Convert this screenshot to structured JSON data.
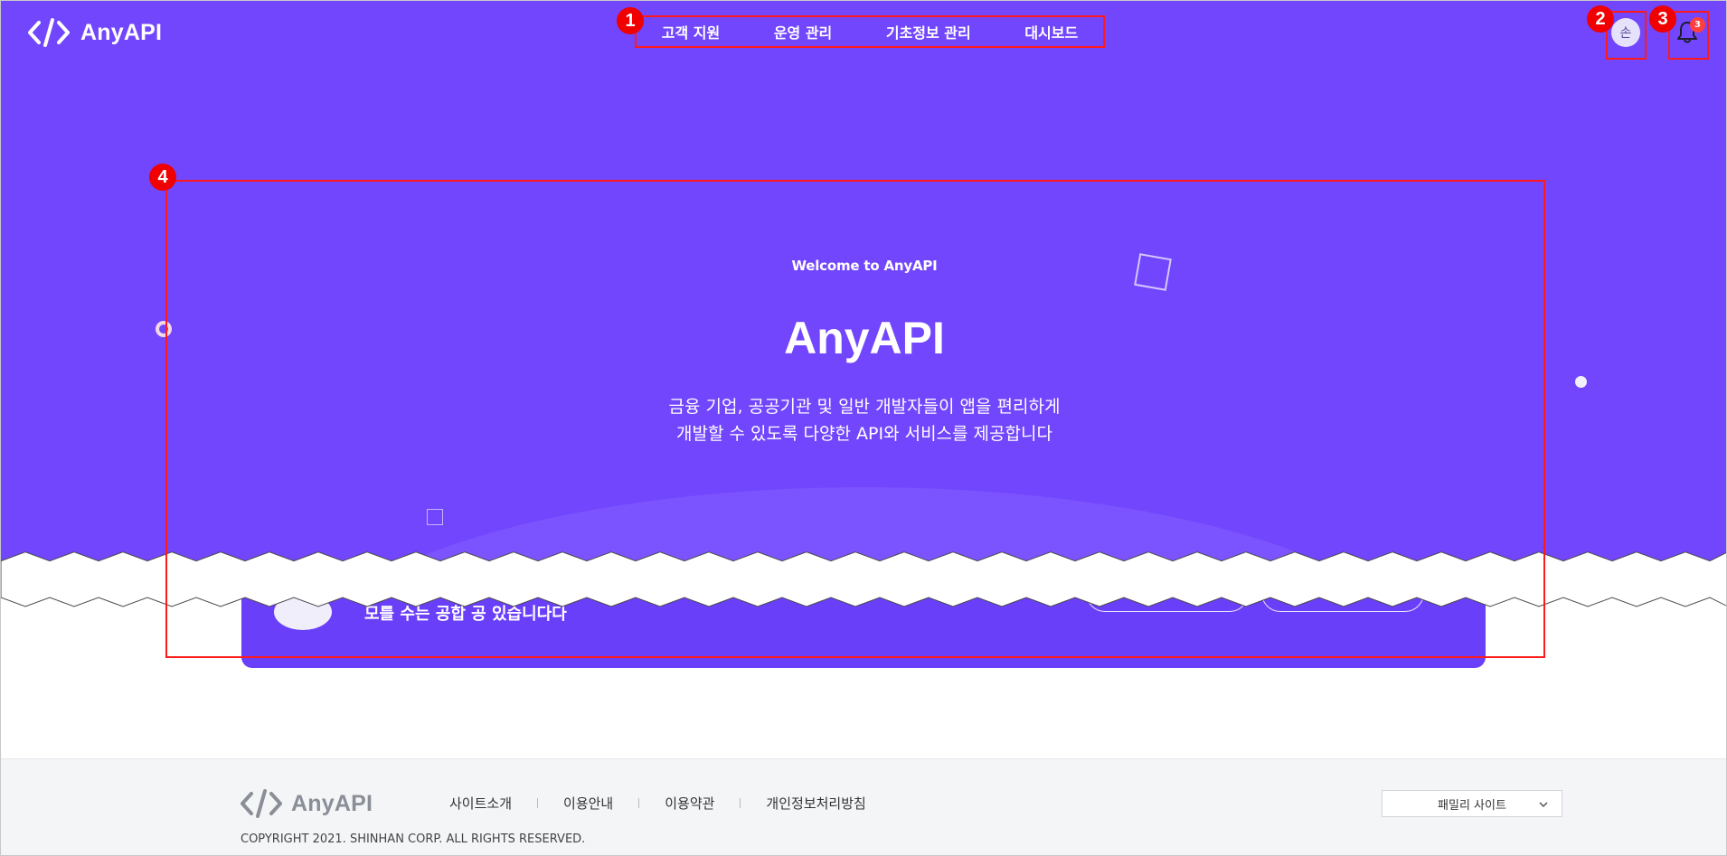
{
  "header": {
    "logo_text": "AnyAPI",
    "nav": [
      "고객 지원",
      "운영 관리",
      "기초정보 관리",
      "대시보드"
    ],
    "avatar_label": "손",
    "notification_count": "3"
  },
  "hero": {
    "welcome": "Welcome to AnyAPI",
    "title": "AnyAPI",
    "description_line1": "금융 기업, 공공기관 및 일반 개발자들이 앱을 편리하게",
    "description_line2": "개발할 수 있도록 다양한 API와 서비스를 제공합니다"
  },
  "banner": {
    "text": "모를 수는 공합 공 있습니다다"
  },
  "annotations": [
    "1",
    "2",
    "3",
    "4"
  ],
  "footer": {
    "logo_text": "AnyAPI",
    "links": [
      "사이트소개",
      "이용안내",
      "이용약관",
      "개인정보처리방침"
    ],
    "copyright": "COPYRIGHT 2021. SHINHAN CORP. ALL RIGHTS RESERVED.",
    "family_site": "패밀리 사이트"
  },
  "colors": {
    "hero_bg": "#7246fd",
    "annotation": "#ff1a1a",
    "footer_bg": "#f4f5f7"
  }
}
